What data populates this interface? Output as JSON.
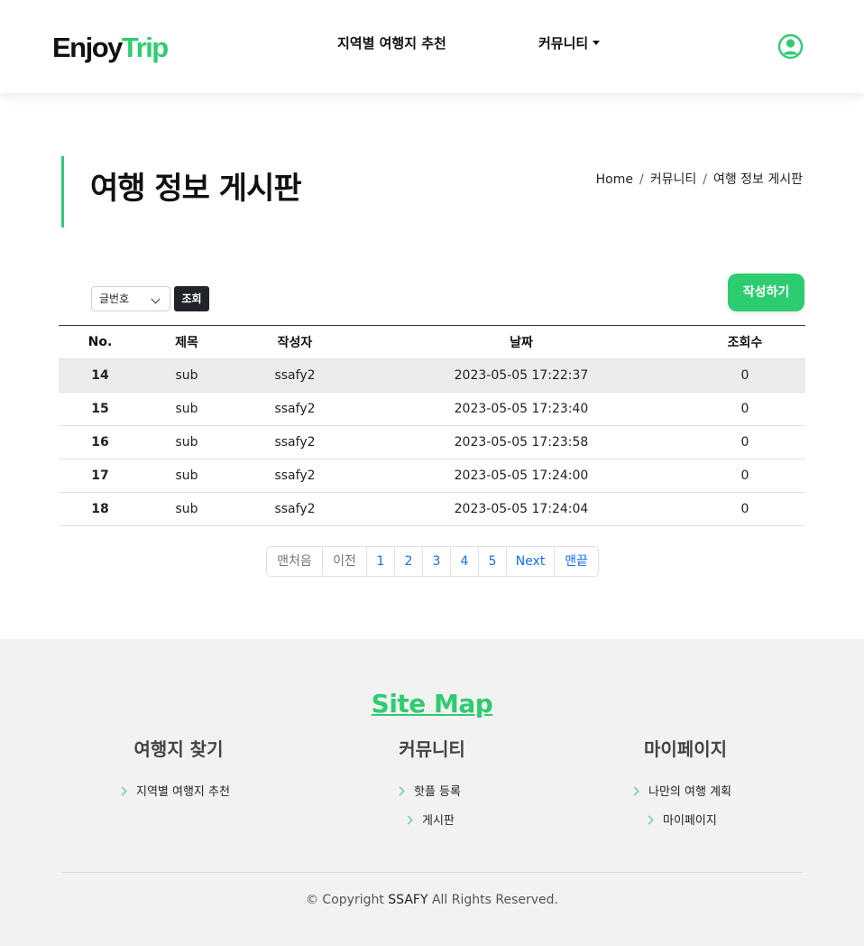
{
  "header": {
    "logo_part1": "Enjoy",
    "logo_part2": "Trip",
    "nav": {
      "region_label": "지역별 여행지 추천",
      "community_label": "커뮤니티"
    },
    "user_icon": "user-circle-icon"
  },
  "page": {
    "title": "여행 정보 게시판",
    "breadcrumb": [
      "Home",
      "커뮤니티",
      "여행 정보 게시판"
    ]
  },
  "controls": {
    "sort_selected": "글번호",
    "search_label": "조회",
    "write_label": "작성하기"
  },
  "table": {
    "headers": [
      "No.",
      "제목",
      "작성자",
      "날짜",
      "조회수"
    ],
    "rows": [
      {
        "no": "14",
        "title": "sub",
        "author": "ssafy2",
        "date": "2023-05-05 17:22:37",
        "views": "0"
      },
      {
        "no": "15",
        "title": "sub",
        "author": "ssafy2",
        "date": "2023-05-05 17:23:40",
        "views": "0"
      },
      {
        "no": "16",
        "title": "sub",
        "author": "ssafy2",
        "date": "2023-05-05 17:23:58",
        "views": "0"
      },
      {
        "no": "17",
        "title": "sub",
        "author": "ssafy2",
        "date": "2023-05-05 17:24:00",
        "views": "0"
      },
      {
        "no": "18",
        "title": "sub",
        "author": "ssafy2",
        "date": "2023-05-05 17:24:04",
        "views": "0"
      }
    ]
  },
  "pagination": {
    "first": "맨처음",
    "prev": "이전",
    "pages": [
      "1",
      "2",
      "3",
      "4",
      "5"
    ],
    "next": "Next",
    "last": "맨끝"
  },
  "footer": {
    "sitemap_title": "Site Map",
    "columns": [
      {
        "title": "여행지 찾기",
        "links": [
          "지역별 여행지 추천"
        ]
      },
      {
        "title": "커뮤니티",
        "links": [
          "핫플 등록",
          "게시판"
        ]
      },
      {
        "title": "마이페이지",
        "links": [
          "나만의 여행 계획",
          "마이페이지"
        ]
      }
    ],
    "copyright_prefix": "© Copyright ",
    "copyright_brand": "SSAFY",
    "copyright_suffix": " All Rights Reserved."
  },
  "colors": {
    "accent": "#2ecc71",
    "dark_button": "#212529",
    "link_blue": "#0d6efd"
  }
}
